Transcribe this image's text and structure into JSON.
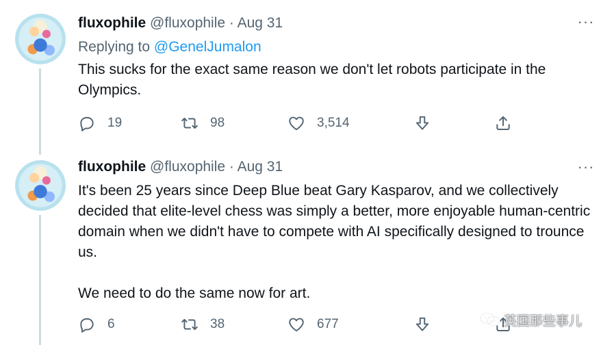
{
  "tweets": [
    {
      "name": "fluxophile",
      "handle": "@fluxophile",
      "separator": "·",
      "date": "Aug 31",
      "replying_prefix": "Replying to",
      "replying_to": "@GenelJumalon",
      "text": "This sucks for the exact same reason we don't let robots participate in the Olympics.",
      "more": "···",
      "replies": "19",
      "retweets": "98",
      "likes": "3,514"
    },
    {
      "name": "fluxophile",
      "handle": "@fluxophile",
      "separator": "·",
      "date": "Aug 31",
      "text": "It's been 25 years since Deep Blue beat Gary Kasparov, and we collectively decided that elite-level chess was simply a better, more enjoyable human-centric domain when we didn't have to compete with AI specifically designed to trounce us.\n\nWe need to do the same now for art.",
      "more": "···",
      "replies": "6",
      "retweets": "38",
      "likes": "677"
    }
  ],
  "watermark": "英国那些事儿",
  "icons": [
    "reply-icon",
    "retweet-icon",
    "like-icon",
    "downvote-icon",
    "share-icon",
    "more-icon",
    "wechat-icon"
  ],
  "colors": {
    "link": "#1d9bf0",
    "muted": "#536471",
    "text": "#0f1419",
    "thread_line": "#cfd9de"
  }
}
